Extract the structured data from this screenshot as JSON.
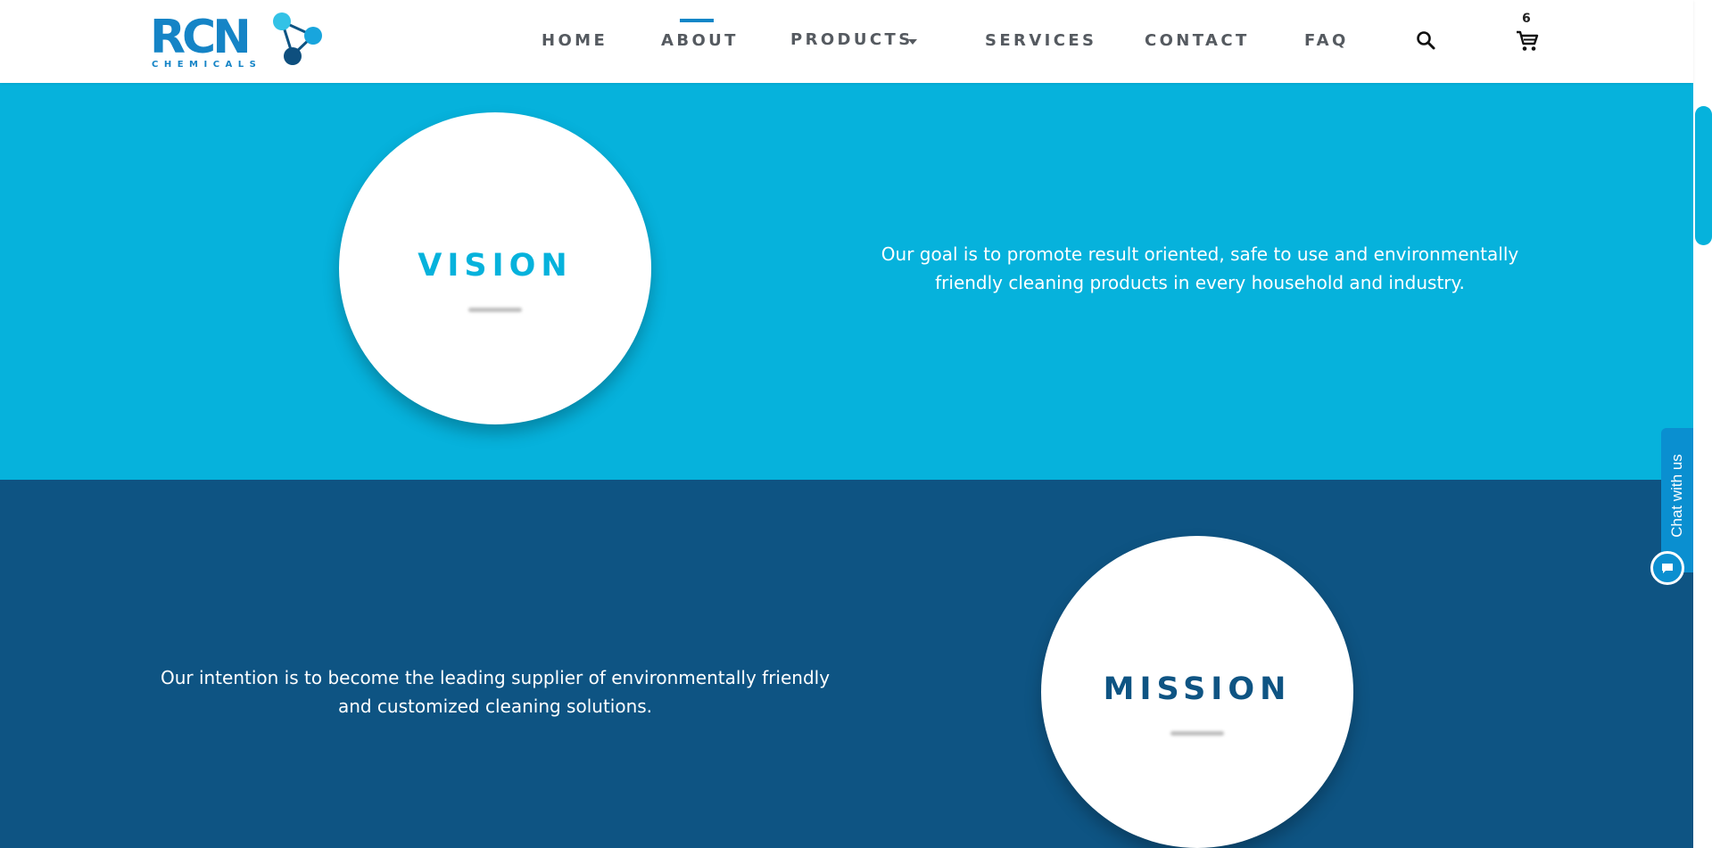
{
  "brand": {
    "logo_text": "RCN",
    "logo_subtext": "CHEMICALS"
  },
  "nav": {
    "items": [
      {
        "label": "HOME"
      },
      {
        "label": "ABOUT",
        "active": true
      },
      {
        "label": "PRODUCTS",
        "has_dropdown": true
      },
      {
        "label": "SERVICES"
      },
      {
        "label": "CONTACT"
      },
      {
        "label": "FAQ"
      }
    ],
    "search_icon": "search-icon",
    "cart_icon": "cart-icon",
    "cart_count": "6"
  },
  "vision": {
    "title": "VISION",
    "text": "Our goal is to promote result oriented, safe to use and environmentally friendly cleaning products in every household and industry."
  },
  "mission": {
    "title": "MISSION",
    "text": "Our intention is to become the leading supplier of environmentally friendly and customized cleaning solutions."
  },
  "chat": {
    "label": "Chat with us",
    "icon": "chat-bubble-icon"
  },
  "colors": {
    "vision_bg": "#06b2dc",
    "mission_bg": "#0e5483",
    "accent": "#0e86c7",
    "nav_text": "#555a60"
  }
}
